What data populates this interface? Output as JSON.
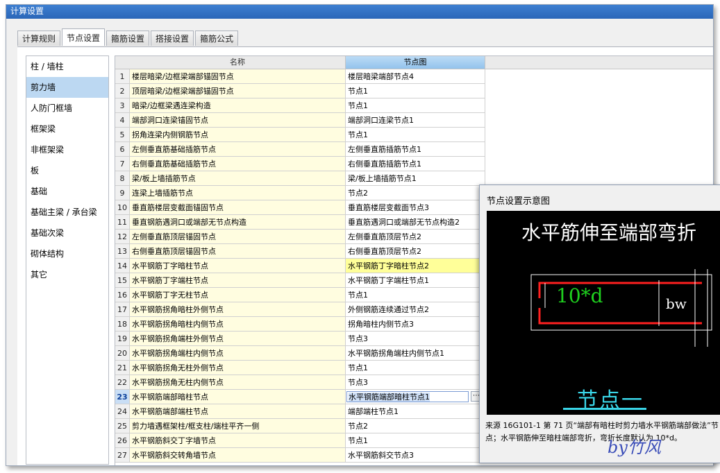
{
  "window": {
    "title": "计算设置"
  },
  "tabs": [
    "计算规则",
    "节点设置",
    "箍筋设置",
    "搭接设置",
    "箍筋公式"
  ],
  "active_tab_index": 1,
  "sidebar": {
    "items": [
      "柱 / 墙柱",
      "剪力墙",
      "人防门框墙",
      "框架梁",
      "非框架梁",
      "板",
      "基础",
      "基础主梁 / 承台梁",
      "基础次梁",
      "砌体结构",
      "其它"
    ],
    "active_index": 1
  },
  "grid": {
    "headers": {
      "name": "名称",
      "node": "节点图"
    },
    "highlight_row": 14,
    "selected_row": 23,
    "rows": [
      {
        "num": "1",
        "name": "楼层暗梁/边框梁端部锚固节点",
        "node": "楼层暗梁端部节点4"
      },
      {
        "num": "2",
        "name": "顶层暗梁/边框梁端部锚固节点",
        "node": "节点1"
      },
      {
        "num": "3",
        "name": "暗梁/边框梁遇连梁构造",
        "node": "节点1"
      },
      {
        "num": "4",
        "name": "端部洞口连梁锚固节点",
        "node": "端部洞口连梁节点1"
      },
      {
        "num": "5",
        "name": "拐角连梁内侧钢筋节点",
        "node": "节点1"
      },
      {
        "num": "6",
        "name": "左侧垂直筋基础插筋节点",
        "node": "左侧垂直筋插筋节点1"
      },
      {
        "num": "7",
        "name": "右侧垂直筋基础插筋节点",
        "node": "右侧垂直筋插筋节点1"
      },
      {
        "num": "8",
        "name": "梁/板上墙插筋节点",
        "node": "梁/板上墙插筋节点1"
      },
      {
        "num": "9",
        "name": "连梁上墙插筋节点",
        "node": "节点2"
      },
      {
        "num": "10",
        "name": "垂直筋楼层变截面锚固节点",
        "node": "垂直筋楼层变截面节点3"
      },
      {
        "num": "11",
        "name": "垂直钢筋遇洞口或端部无节点构造",
        "node": "垂直筋遇洞口或端部无节点构造2"
      },
      {
        "num": "12",
        "name": "左侧垂直筋顶层锚固节点",
        "node": "左侧垂直筋顶层节点2"
      },
      {
        "num": "13",
        "name": "右侧垂直筋顶层锚固节点",
        "node": "右侧垂直筋顶层节点2"
      },
      {
        "num": "14",
        "name": "水平钢筋丁字暗柱节点",
        "node": "水平钢筋丁字暗柱节点2"
      },
      {
        "num": "15",
        "name": "水平钢筋丁字端柱节点",
        "node": "水平钢筋丁字端柱节点1"
      },
      {
        "num": "16",
        "name": "水平钢筋丁字无柱节点",
        "node": "节点1"
      },
      {
        "num": "17",
        "name": "水平钢筋拐角暗柱外侧节点",
        "node": "外侧钢筋连续通过节点2"
      },
      {
        "num": "18",
        "name": "水平钢筋拐角暗柱内侧节点",
        "node": "拐角暗柱内侧节点3"
      },
      {
        "num": "19",
        "name": "水平钢筋拐角端柱外侧节点",
        "node": "节点3"
      },
      {
        "num": "20",
        "name": "水平钢筋拐角端柱内侧节点",
        "node": "水平钢筋拐角端柱内侧节点1"
      },
      {
        "num": "21",
        "name": "水平钢筋拐角无柱外侧节点",
        "node": "节点1"
      },
      {
        "num": "22",
        "name": "水平钢筋拐角无柱内侧节点",
        "node": "节点3"
      },
      {
        "num": "23",
        "name": "水平钢筋端部暗柱节点",
        "node": "水平钢筋端部暗柱节点1"
      },
      {
        "num": "24",
        "name": "水平钢筋端部端柱节点",
        "node": "端部端柱节点1"
      },
      {
        "num": "25",
        "name": "剪力墙遇框架柱/框支柱/端柱平齐一侧",
        "node": "节点2"
      },
      {
        "num": "26",
        "name": "水平钢筋斜交丁字墙节点",
        "node": "节点1"
      },
      {
        "num": "27",
        "name": "水平钢筋斜交转角墙节点",
        "node": "水平钢筋斜交节点3"
      }
    ]
  },
  "popup": {
    "title": "节点设置示意图",
    "diagram_title": "水平筋伸至端部弯折",
    "diagram_label_left": "10*d",
    "diagram_label_right": "bw",
    "diagram_node_name": "节点一",
    "caption": "来源 16G101-1 第 71 页“端部有暗柱时剪力墙水平钢筋端部做法”节点；水平钢筋伸至暗柱端部弯折，弯折长度默认为 10*d。"
  },
  "signature": "by竹风",
  "colors": {
    "accent": "#2a66b8",
    "name_cell": "#fffde0",
    "highlight": "#ffff99",
    "header_active": "#93c3ec"
  }
}
